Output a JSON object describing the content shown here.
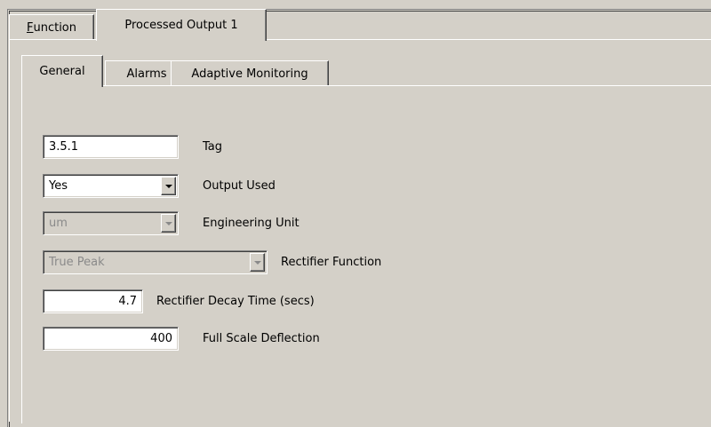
{
  "outer_tabs": [
    {
      "label_first": "F",
      "label_rest": "unction",
      "active": false
    },
    {
      "label": "Processed Output 1",
      "active": true
    }
  ],
  "inner_tabs": [
    {
      "label": "General",
      "active": true
    },
    {
      "label": "Alarms",
      "active": false
    },
    {
      "label": "Adaptive Monitoring",
      "active": false
    }
  ],
  "form": {
    "tag": {
      "value": "3.5.1",
      "label": "Tag"
    },
    "output_used": {
      "value": "Yes",
      "label": "Output Used"
    },
    "engineering_unit": {
      "value": "um",
      "label": "Engineering Unit"
    },
    "rectifier_function": {
      "value": "True Peak",
      "label": "Rectifier Function"
    },
    "rectifier_decay_time": {
      "value": "4.7",
      "label": "Rectifier Decay Time (secs)"
    },
    "full_scale_deflection": {
      "value": "400",
      "label": "Full Scale Deflection"
    }
  },
  "colors": {
    "window_bg": "#d4d0c8",
    "disabled_text": "#8a8a8a"
  }
}
